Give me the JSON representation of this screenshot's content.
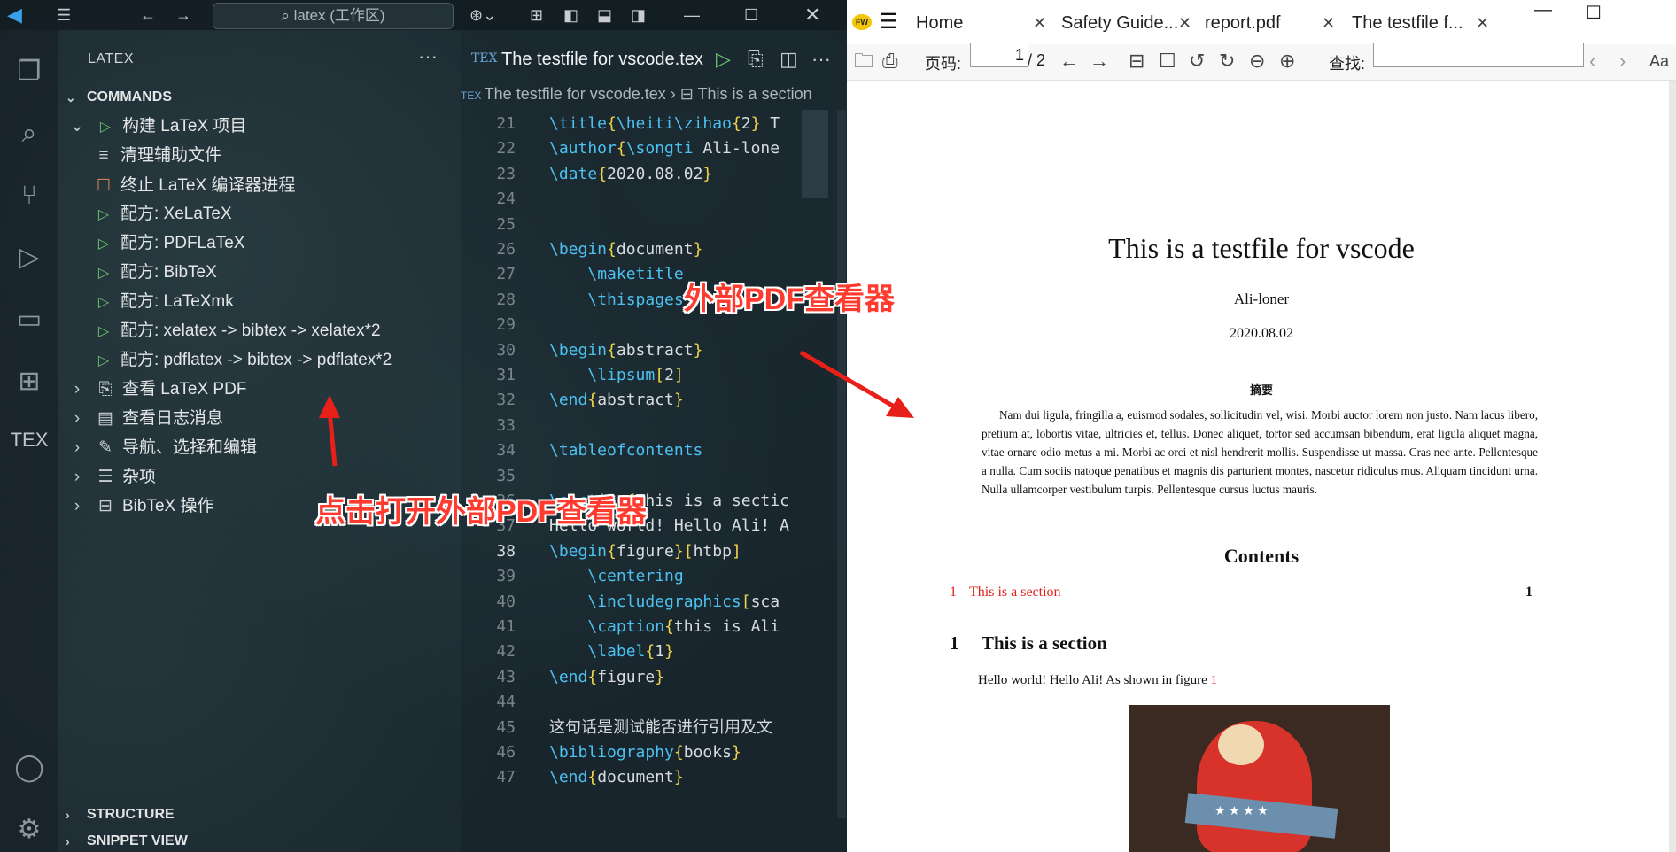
{
  "vscode": {
    "search_text": "latex (工作区)",
    "sidebar_title": "LATEX",
    "more": "···",
    "commands_header": "COMMANDS",
    "build_item": "构建 LaTeX 项目",
    "build_children": [
      "清理辅助文件",
      "终止 LaTeX 编译器进程",
      "配方: XeLaTeX",
      "配方: PDFLaTeX",
      "配方: BibTeX",
      "配方: LaTeXmk",
      "配方: xelatex -> bibtex -> xelatex*2",
      "配方: pdflatex -> bibtex -> pdflatex*2"
    ],
    "groups": [
      "查看 LaTeX PDF",
      "查看日志消息",
      "导航、选择和编辑",
      "杂项",
      "BibTeX 操作"
    ],
    "structure_header": "STRUCTURE",
    "snippet_header": "SNIPPET VIEW",
    "tex_label": "TEX",
    "tab_title": "The testfile for vscode.tex",
    "breadcrumb_file": "The testfile for vscode.tex",
    "breadcrumb_section": "This is a section",
    "code_lines": [
      {
        "n": "21",
        "t": "\\title{\\heiti\\zihao{2} T"
      },
      {
        "n": "22",
        "t": "\\author{\\songti Ali-lone"
      },
      {
        "n": "23",
        "t": "\\date{2020.08.02}"
      },
      {
        "n": "24",
        "t": ""
      },
      {
        "n": "25",
        "t": ""
      },
      {
        "n": "26",
        "t": "\\begin{document}"
      },
      {
        "n": "27",
        "t": "    \\maketitle"
      },
      {
        "n": "28",
        "t": "    \\thispages"
      },
      {
        "n": "29",
        "t": ""
      },
      {
        "n": "30",
        "t": "\\begin{abstract}"
      },
      {
        "n": "31",
        "t": "    \\lipsum[2]"
      },
      {
        "n": "32",
        "t": "\\end{abstract}"
      },
      {
        "n": "33",
        "t": ""
      },
      {
        "n": "34",
        "t": "\\tableofcontents"
      },
      {
        "n": "35",
        "t": ""
      },
      {
        "n": "36",
        "t": "\\section{This is a sectic"
      },
      {
        "n": "37",
        "t": "Hello world! Hello Ali! A"
      },
      {
        "n": "38",
        "t": "\\begin{figure}[htbp]"
      },
      {
        "n": "39",
        "t": "    \\centering"
      },
      {
        "n": "40",
        "t": "    \\includegraphics[sca"
      },
      {
        "n": "41",
        "t": "    \\caption{this is Ali"
      },
      {
        "n": "42",
        "t": "    \\label{1}"
      },
      {
        "n": "43",
        "t": "\\end{figure}"
      },
      {
        "n": "44",
        "t": ""
      },
      {
        "n": "45",
        "t": "这句话是测试能否进行引用及文"
      },
      {
        "n": "46",
        "t": "\\bibliography{books}"
      },
      {
        "n": "47",
        "t": "\\end{document}"
      }
    ]
  },
  "viewer": {
    "tabs": [
      "Home",
      "Safety Guide...",
      "report.pdf",
      "The testfile f..."
    ],
    "page_label": "页码:",
    "page_value": "1",
    "page_total": "/ 2",
    "find_label": "查找:",
    "doc": {
      "title": "This is a testfile for vscode",
      "author": "Ali-loner",
      "date": "2020.08.02",
      "abstract_heading": "摘要",
      "abstract_text": "Nam dui ligula, fringilla a, euismod sodales, sollicitudin vel, wisi. Morbi auctor lorem non justo. Nam lacus libero, pretium at, lobortis vitae, ultricies et, tellus. Donec aliquet, tortor sed accumsan bibendum, erat ligula aliquet magna, vitae ornare odio metus a mi. Morbi ac orci et nisl hendrerit mollis. Suspendisse ut massa. Cras nec ante. Pellentesque a nulla. Cum sociis natoque penatibus et magnis dis parturient montes, nascetur ridiculus mus. Aliquam tincidunt urna. Nulla ullamcorper vestibulum turpis. Pellentesque cursus luctus mauris.",
      "contents_heading": "Contents",
      "toc_number": "1",
      "toc_title": "This is a section",
      "toc_page": "1",
      "section_number": "1",
      "section_title": "This is a section",
      "body_text": "Hello world! Hello Ali! As shown in figure ",
      "figure_ref": "1"
    }
  },
  "annotations": {
    "top": "外部PDF查看器",
    "bottom": "点击打开外部PDF查看器"
  },
  "colors": {
    "annotation_red": "#ff3b30",
    "link_red": "#e0201a",
    "play_green": "#6fc66f"
  }
}
